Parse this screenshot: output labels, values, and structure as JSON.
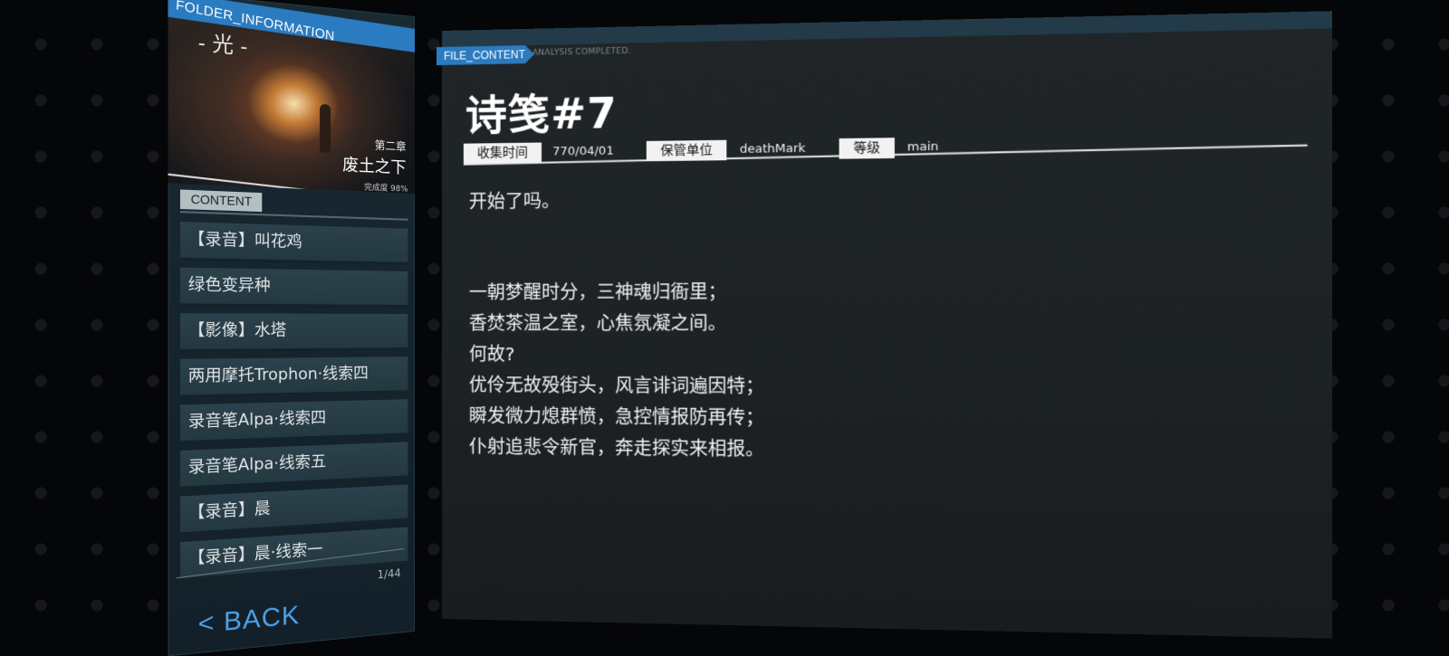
{
  "folder": {
    "header": "FOLDER_INFORMATION",
    "cover": {
      "title": "- 光 -",
      "chapter": "第二章",
      "chapter_name": "废土之下",
      "progress": "完成度 98%"
    },
    "content_tab": "CONTENT",
    "items": [
      {
        "label": "【录音】叫花鸡"
      },
      {
        "label": "绿色变异种"
      },
      {
        "label": "【影像】水塔"
      },
      {
        "label": "两用摩托Trophon·线索四"
      },
      {
        "label": "录音笔Alpa·线索四"
      },
      {
        "label": "录音笔Alpa·线索五"
      },
      {
        "label": "【录音】晨"
      },
      {
        "label": "【录音】晨·线索一"
      }
    ],
    "page_count": "1/44",
    "back_label": "< BACK"
  },
  "file": {
    "tab": "FILE_CONTENT",
    "status": "ANALYSIS COMPLETED.",
    "title": "诗笺#7",
    "meta": {
      "collect_time_label": "收集时间",
      "collect_time_value": "770/04/01",
      "custodian_label": "保管单位",
      "custodian_value": "deathMark",
      "level_label": "等级",
      "level_value": "main"
    },
    "opening": "开始了吗。",
    "lines": [
      "一朝梦醒时分，三神魂归衙里；",
      "香焚茶温之室，心焦氛凝之间。",
      "何故?",
      "优伶无故殁街头，风言诽词遍因特；",
      "瞬发微力熄群愤，急控情报防再传；",
      "仆射追悲令新官，奔走探实来相报。"
    ]
  },
  "colors": {
    "accent_blue": "#2b7bc0",
    "back_blue": "#4aa0e8",
    "panel_dark": "#1d2225"
  }
}
